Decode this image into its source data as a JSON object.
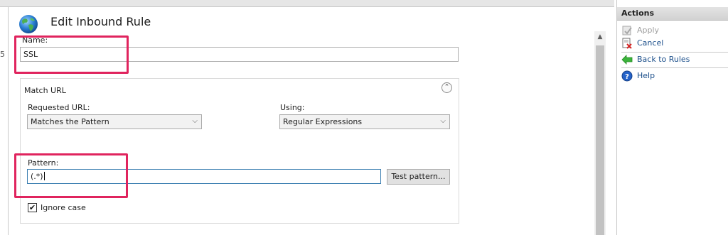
{
  "left_cut_text": "5",
  "dialog": {
    "title": "Edit Inbound Rule",
    "name_label": "Name:",
    "name_value": "SSL"
  },
  "match_url": {
    "header": "Match URL",
    "requested_url_label": "Requested URL:",
    "requested_url_value": "Matches the Pattern",
    "using_label": "Using:",
    "using_value": "Regular Expressions",
    "pattern_label": "Pattern:",
    "pattern_value": "(.*)",
    "test_pattern_button": "Test pattern...",
    "ignore_case_label": "Ignore case",
    "ignore_case_checked": true
  },
  "actions": {
    "header": "Actions",
    "items": [
      {
        "label": "Apply",
        "icon": "apply-icon",
        "enabled": false
      },
      {
        "label": "Cancel",
        "icon": "cancel-icon",
        "enabled": true
      },
      {
        "label": "Back to Rules",
        "icon": "back-arrow-icon",
        "enabled": true
      },
      {
        "label": "Help",
        "icon": "help-icon",
        "enabled": true
      }
    ]
  },
  "colors": {
    "highlight": "#e0245e",
    "link": "#1a4e8a",
    "focus_border": "#3c7fb1"
  }
}
